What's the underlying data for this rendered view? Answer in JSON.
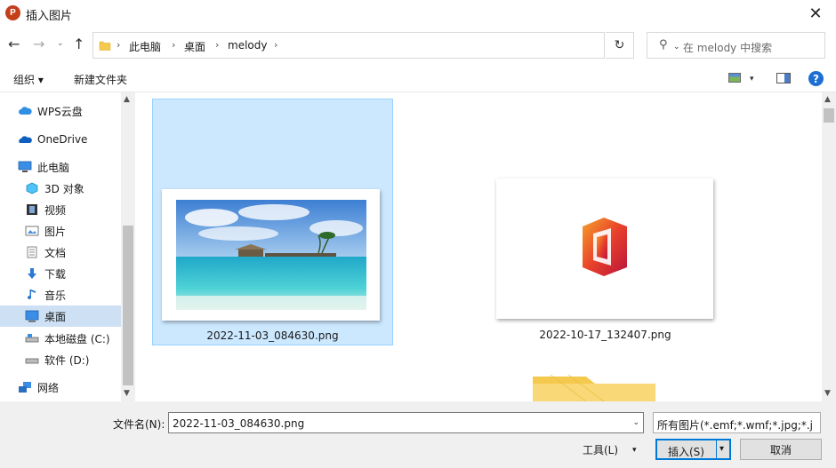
{
  "window": {
    "title": "插入图片",
    "app_icon_letter": "P",
    "close_glyph": "✕"
  },
  "nav": {
    "back_glyph": "←",
    "forward_glyph": "→",
    "recent_glyph": "⌄",
    "up_glyph": "↑",
    "breadcrumbs": [
      "此电脑",
      "桌面",
      "melody"
    ],
    "separator": "›",
    "dropdown_glyph": "⌄",
    "refresh_glyph": "↻"
  },
  "search": {
    "placeholder": "在 melody 中搜索",
    "icon_glyph": "⚲"
  },
  "toolbar": {
    "organize_label": "组织 ▾",
    "new_folder_label": "新建文件夹",
    "view_dropdown_glyph": "▾",
    "help_glyph": "?"
  },
  "sidebar": {
    "items": [
      {
        "label": "WPS云盘",
        "icon": "cloud-icon"
      },
      {
        "label": "OneDrive",
        "icon": "onedrive-icon"
      },
      {
        "label": "此电脑",
        "icon": "computer-icon"
      },
      {
        "label": "3D 对象",
        "icon": "3d-objects-icon"
      },
      {
        "label": "视频",
        "icon": "video-icon"
      },
      {
        "label": "图片",
        "icon": "pictures-icon"
      },
      {
        "label": "文档",
        "icon": "documents-icon"
      },
      {
        "label": "下载",
        "icon": "download-icon"
      },
      {
        "label": "音乐",
        "icon": "music-icon"
      },
      {
        "label": "桌面",
        "icon": "desktop-icon"
      },
      {
        "label": "本地磁盘 (C:)",
        "icon": "drive-icon"
      },
      {
        "label": "软件 (D:)",
        "icon": "drive-icon"
      },
      {
        "label": "网络",
        "icon": "network-icon"
      }
    ],
    "selected_index": 9,
    "scroll_up_glyph": "▲",
    "scroll_down_glyph": "▼"
  },
  "files": [
    {
      "name": "2022-11-03_084630.png",
      "selected": true
    },
    {
      "name": "2022-10-17_132407.png",
      "selected": false
    }
  ],
  "bottom": {
    "filename_label": "文件名(N):",
    "filename_value": "2022-11-03_084630.png",
    "filter_value": "所有图片(*.emf;*.wmf;*.jpg;*.j",
    "tools_label": "工具(L)",
    "insert_label": "插入(S)",
    "cancel_label": "取消"
  },
  "colors": {
    "selection": "#cce8ff",
    "accent": "#0078d7",
    "folder": "#f4c94e"
  }
}
